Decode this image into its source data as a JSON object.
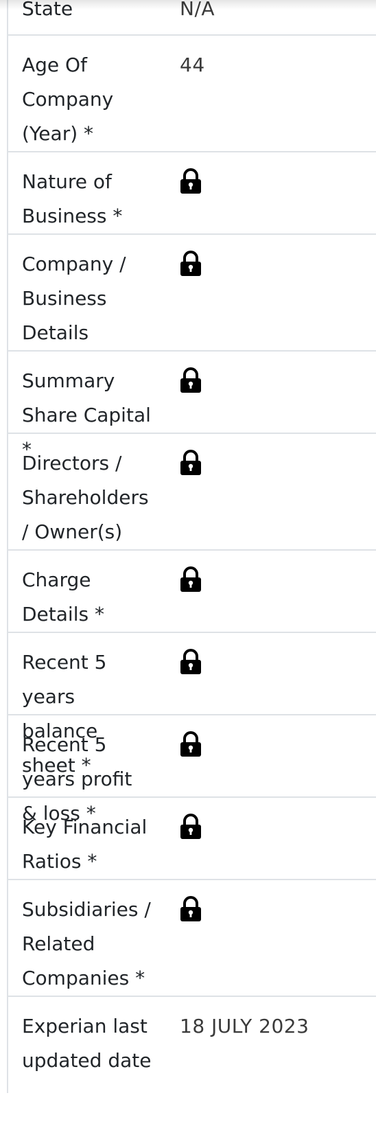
{
  "rows": [
    {
      "label": "State",
      "value": "N/A",
      "locked": false
    },
    {
      "label": "Age Of Company (Year) *",
      "value": "44",
      "locked": false
    },
    {
      "label": "Nature of Business *",
      "value": "",
      "locked": true
    },
    {
      "label": "Company / Business Details",
      "value": "",
      "locked": true
    },
    {
      "label": "Summary Share Capital *",
      "value": "",
      "locked": true
    },
    {
      "label": "Directors / Shareholders / Owner(s)",
      "value": "",
      "locked": true
    },
    {
      "label": "Charge Details *",
      "value": "",
      "locked": true
    },
    {
      "label": "Recent 5 years balance sheet *",
      "value": "",
      "locked": true
    },
    {
      "label": "Recent 5 years profit & loss *",
      "value": "",
      "locked": true
    },
    {
      "label": "Key Financial Ratios *",
      "value": "",
      "locked": true
    },
    {
      "label": "Subsidiaries / Related Companies *",
      "value": "",
      "locked": true
    },
    {
      "label": "Experian last updated date",
      "value": "18 JULY 2023",
      "locked": false
    }
  ],
  "icons": {
    "locked": "lock-icon"
  }
}
